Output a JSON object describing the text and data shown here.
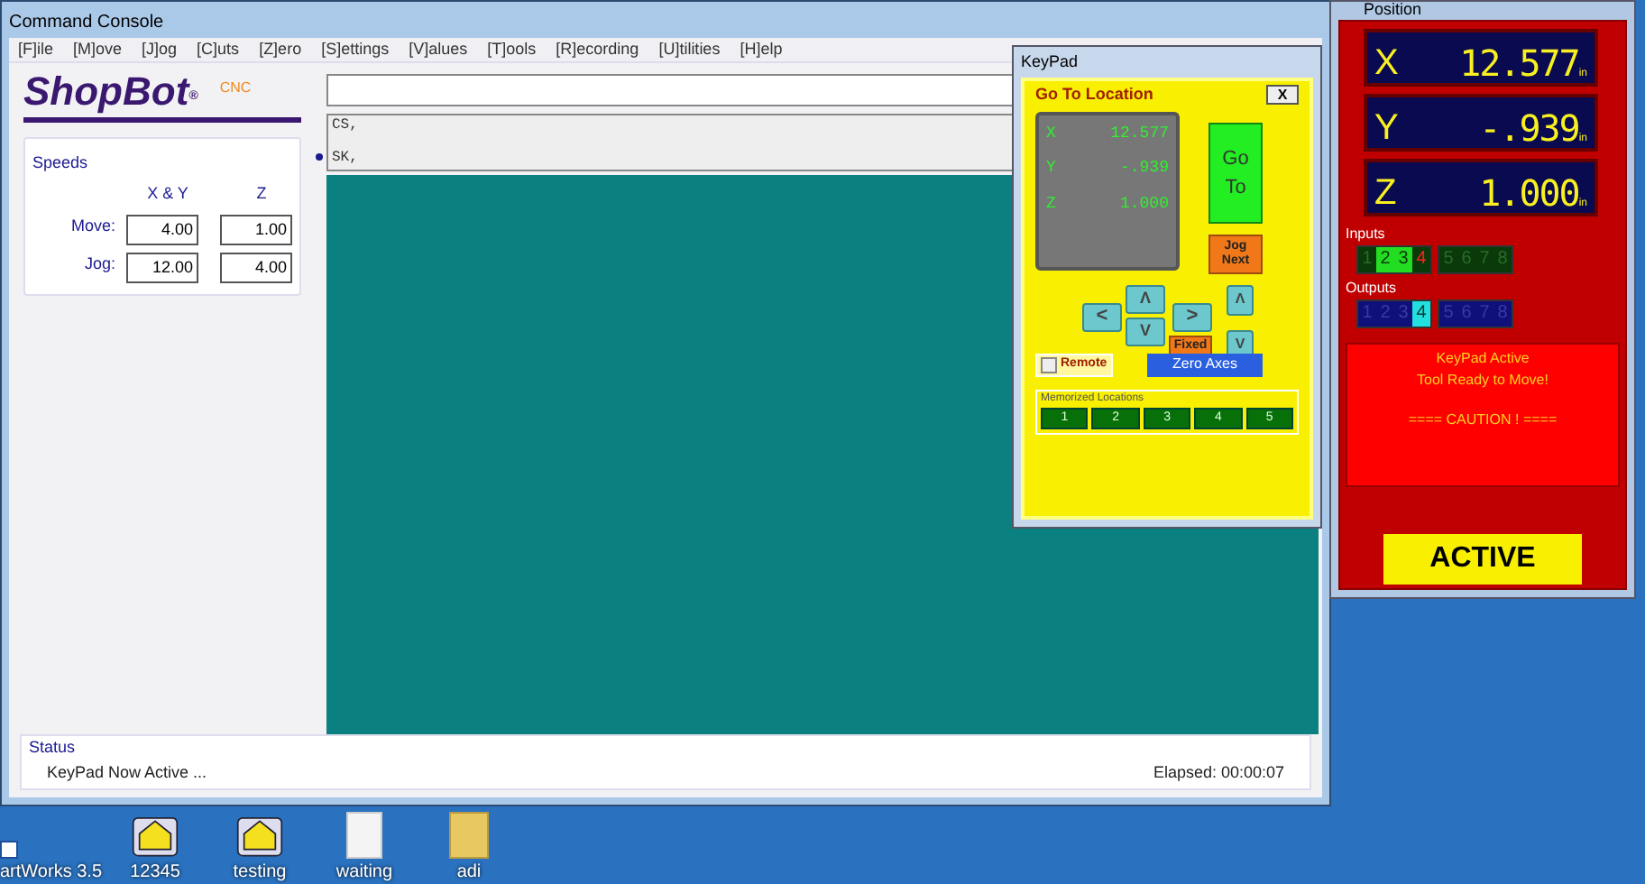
{
  "console": {
    "title": "Command Console",
    "menu": [
      "[F]ile",
      "[M]ove",
      "[J]og",
      "[C]uts",
      "[Z]ero",
      "[S]ettings",
      "[V]alues",
      "[T]ools",
      "[R]ecording",
      "[U]tilities",
      "[H]elp"
    ],
    "logo": {
      "name": "ShopBot",
      "mark": "®",
      "suffix": "CNC"
    },
    "speeds": {
      "title": "Speeds",
      "columns": [
        "X & Y",
        "Z"
      ],
      "rows": [
        {
          "label": "Move:",
          "values": [
            "4.00",
            "1.00"
          ]
        },
        {
          "label": "Jog:",
          "values": [
            "12.00",
            "4.00"
          ]
        }
      ]
    },
    "log": [
      "CS,",
      "SK,"
    ],
    "status": {
      "title": "Status",
      "message": "KeyPad Now Active ...",
      "elapsed": "Elapsed: 00:00:07"
    }
  },
  "keypad": {
    "title": "KeyPad",
    "heading": "Go To Location",
    "close": "X",
    "readout": [
      {
        "axis": "X",
        "value": "12.577"
      },
      {
        "axis": "Y",
        "value": "-.939"
      },
      {
        "axis": "Z",
        "value": "1.000"
      }
    ],
    "go": "Go To",
    "jog_next": "Jog Next",
    "left": "<",
    "up": "Λ",
    "down": "V",
    "right": ">",
    "z_up": "Λ",
    "z_down": "V",
    "fixed": "Fixed",
    "remote": {
      "label": "Remote",
      "checked": false
    },
    "zero": "Zero Axes",
    "memorized_title": "Memorized Locations",
    "memorized": [
      "1",
      "2",
      "3",
      "4",
      "5"
    ]
  },
  "position": {
    "title": "Position",
    "axes": [
      {
        "axis": "X",
        "value": "12.577",
        "unit": "in"
      },
      {
        "axis": "Y",
        "value": "-.939",
        "unit": "in"
      },
      {
        "axis": "Z",
        "value": "1.000",
        "unit": "in"
      }
    ],
    "inputs_title": "Inputs",
    "inputs": [
      {
        "label": "1",
        "on": false,
        "fault": false
      },
      {
        "label": "2",
        "on": true,
        "fault": false
      },
      {
        "label": "3",
        "on": true,
        "fault": false
      },
      {
        "label": "4",
        "on": false,
        "fault": true
      },
      {
        "label": "5",
        "on": false,
        "fault": false
      },
      {
        "label": "6",
        "on": false,
        "fault": false
      },
      {
        "label": "7",
        "on": false,
        "fault": false
      },
      {
        "label": "8",
        "on": false,
        "fault": false
      }
    ],
    "outputs_title": "Outputs",
    "outputs": [
      {
        "label": "1",
        "on": false
      },
      {
        "label": "2",
        "on": false
      },
      {
        "label": "3",
        "on": false
      },
      {
        "label": "4",
        "on": true
      },
      {
        "label": "5",
        "on": false
      },
      {
        "label": "6",
        "on": false
      },
      {
        "label": "7",
        "on": false
      },
      {
        "label": "8",
        "on": false
      }
    ],
    "message": [
      "KeyPad Active",
      "Tool Ready to Move!",
      "==== CAUTION ! ===="
    ],
    "status": "ACTIVE"
  },
  "desktop_icons": [
    {
      "label": "artWorks 3.5",
      "kind": "shortcut"
    },
    {
      "label": "12345",
      "kind": "app"
    },
    {
      "label": "testing",
      "kind": "app"
    },
    {
      "label": "waiting",
      "kind": "file"
    },
    {
      "label": "adi",
      "kind": "folder"
    }
  ]
}
